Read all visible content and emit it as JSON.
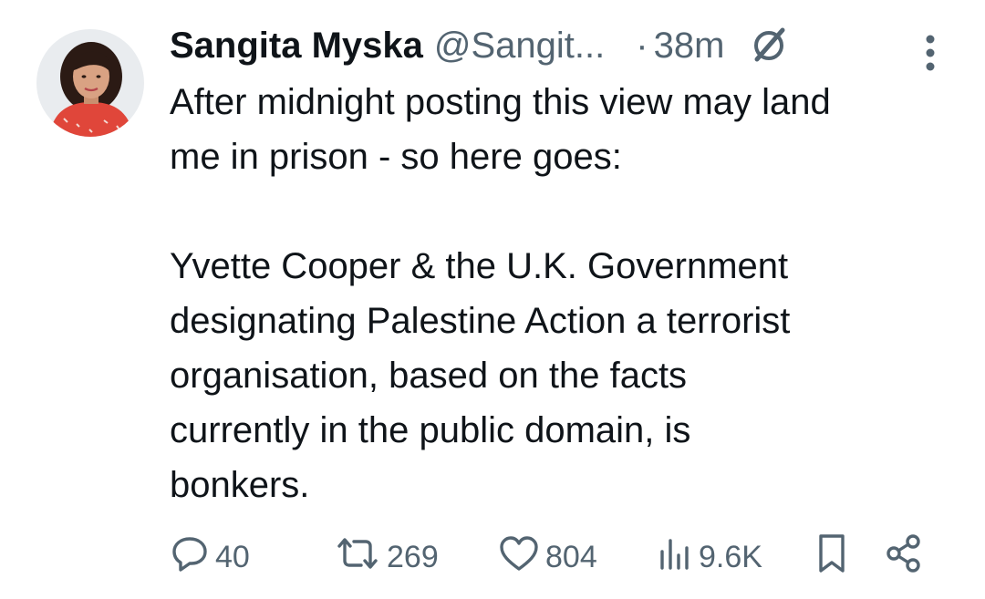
{
  "tweet": {
    "author_name": "Sangita Myska",
    "author_handle": "@Sangit...",
    "separator": "·",
    "time": "38m",
    "text_para1": "After midnight posting this view may land\nme in prison - so here goes:",
    "text_para2": "Yvette Cooper & the U.K. Government\ndesignating Palestine Action a terrorist\norganisation, based on the facts\ncurrently in the public domain, is\nbonkers."
  },
  "actions": {
    "replies": "40",
    "reposts": "269",
    "likes": "804",
    "views": "9.6K"
  },
  "icons": {
    "grok": "grok-icon",
    "more": "more-vertical-icon",
    "reply": "reply-icon",
    "repost": "repost-icon",
    "like": "heart-icon",
    "views": "views-icon",
    "bookmark": "bookmark-icon",
    "share": "share-icon"
  },
  "colors": {
    "text_primary": "#0f1419",
    "text_secondary": "#536471",
    "avatar_shirt": "#e0463a"
  }
}
